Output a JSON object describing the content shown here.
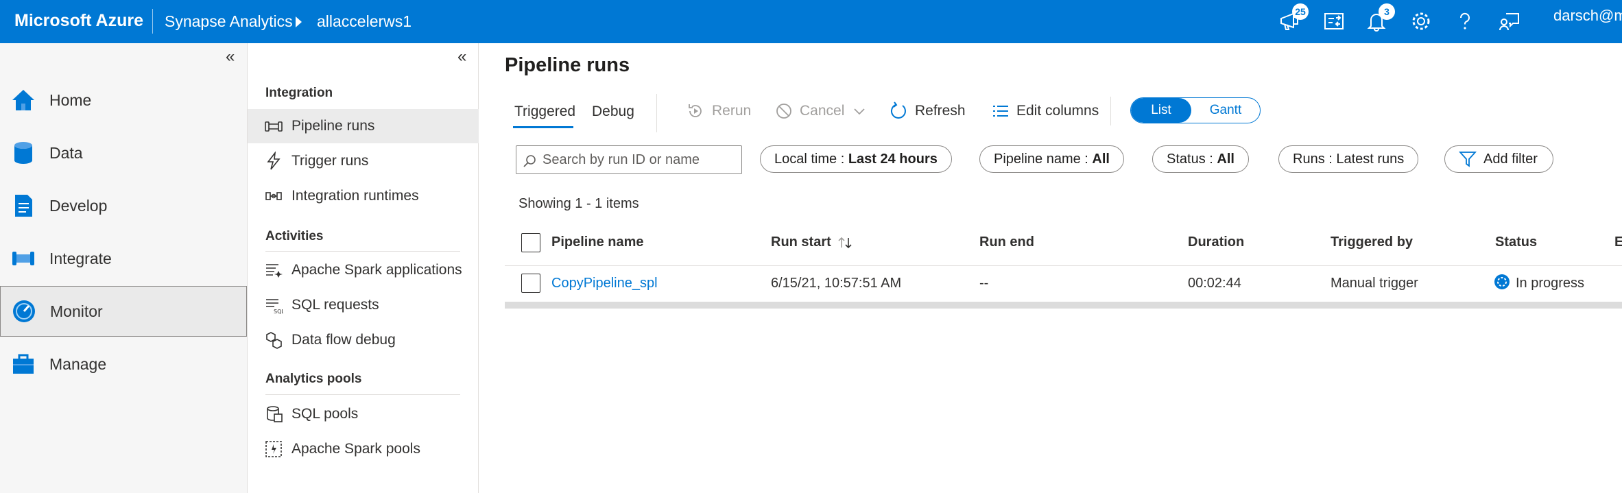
{
  "topbar": {
    "brand": "Microsoft Azure",
    "breadcrumb_service": "Synapse Analytics",
    "breadcrumb_workspace": "allaccelerws1",
    "feedback_badge": "25",
    "notifications_badge": "3",
    "user": "darsch@m"
  },
  "leftnav": {
    "collapse_glyph": "«",
    "items": [
      {
        "label": "Home",
        "icon": "home-icon"
      },
      {
        "label": "Data",
        "icon": "database-icon"
      },
      {
        "label": "Develop",
        "icon": "document-icon"
      },
      {
        "label": "Integrate",
        "icon": "pipeline-icon"
      },
      {
        "label": "Monitor",
        "icon": "monitor-gauge-icon",
        "active": true
      },
      {
        "label": "Manage",
        "icon": "toolbox-icon"
      }
    ]
  },
  "subnav": {
    "collapse_glyph": "«",
    "sections": {
      "integration": "Integration",
      "activities": "Activities",
      "analytics_pools": "Analytics pools"
    },
    "items": {
      "pipeline_runs": "Pipeline runs",
      "trigger_runs": "Trigger runs",
      "integration_runtimes": "Integration runtimes",
      "spark_applications": "Apache Spark applications",
      "sql_requests": "SQL requests",
      "data_flow_debug": "Data flow debug",
      "sql_pools": "SQL pools",
      "spark_pools": "Apache Spark pools"
    }
  },
  "main": {
    "title": "Pipeline runs",
    "tabs": {
      "triggered": "Triggered",
      "debug": "Debug"
    },
    "toolbar": {
      "rerun": "Rerun",
      "cancel": "Cancel",
      "refresh": "Refresh",
      "edit_columns": "Edit columns"
    },
    "view_toggle": {
      "list": "List",
      "gantt": "Gantt",
      "selected": "List"
    },
    "search_placeholder": "Search by run ID or name",
    "filters": {
      "local_time_label": "Local time : ",
      "local_time_value": "Last 24 hours",
      "pipeline_name_label": "Pipeline name : ",
      "pipeline_name_value": "All",
      "status_label": "Status : ",
      "status_value": "All",
      "runs": "Runs : Latest runs",
      "add_filter": "Add filter"
    },
    "showing": "Showing 1 - 1 items",
    "table": {
      "columns": {
        "pipeline_name": "Pipeline name",
        "run_start": "Run start",
        "run_end": "Run end",
        "duration": "Duration",
        "triggered_by": "Triggered by",
        "status": "Status",
        "overflow": "E"
      },
      "rows": [
        {
          "pipeline_name": "CopyPipeline_spl",
          "run_start": "6/15/21, 10:57:51 AM",
          "run_end": "--",
          "duration": "00:02:44",
          "triggered_by": "Manual trigger",
          "status": "In progress"
        }
      ]
    }
  },
  "colors": {
    "azure_blue": "#0078d4",
    "nav_bg": "#f6f6f6",
    "text": "#323130",
    "disabled": "#a19f9d"
  }
}
